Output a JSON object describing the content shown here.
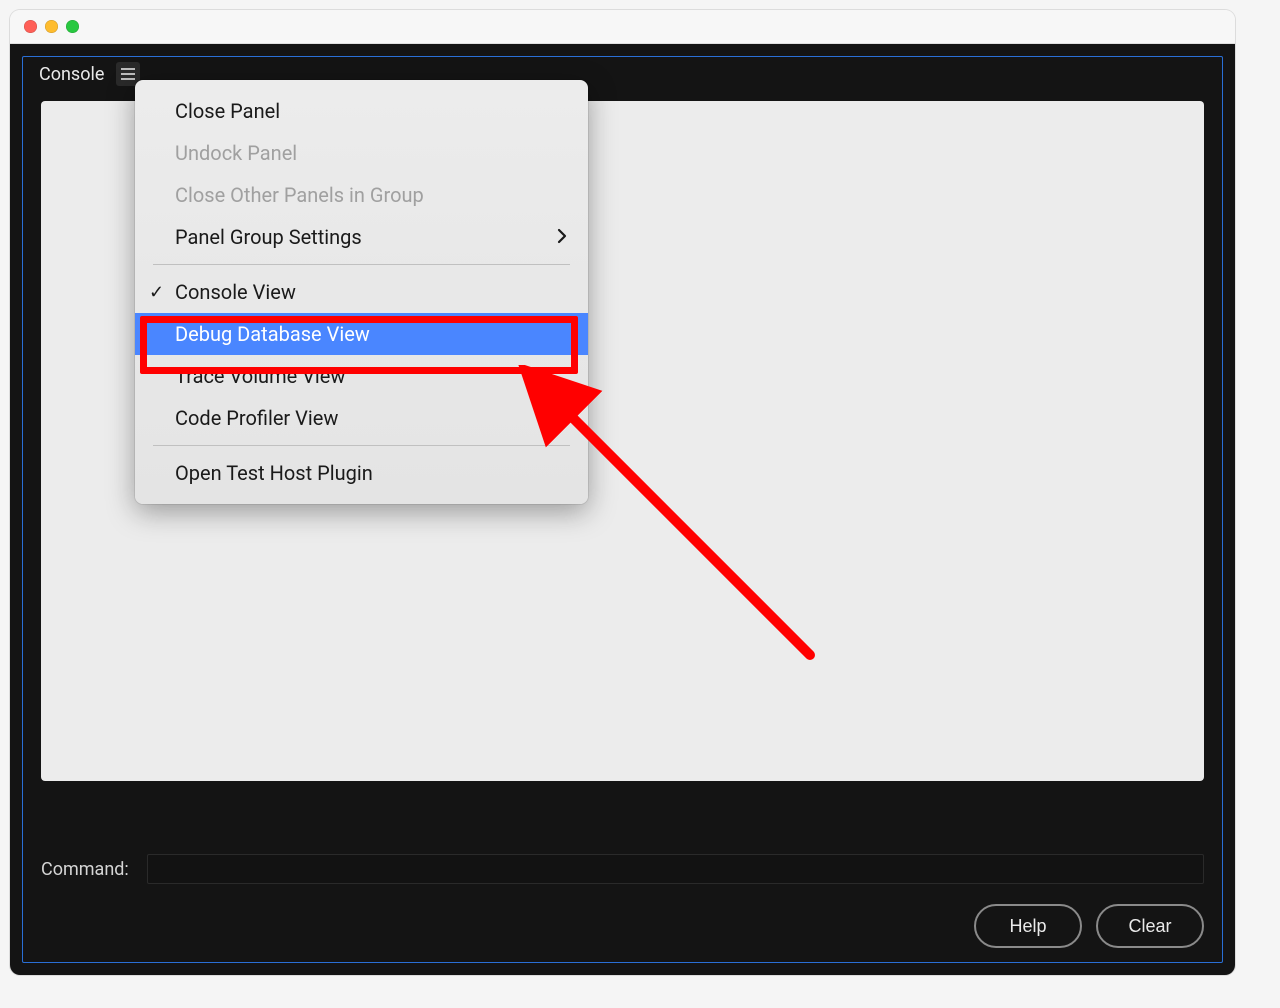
{
  "window": {
    "tab_title": "Console"
  },
  "menu": {
    "close_panel": "Close Panel",
    "undock_panel": "Undock Panel",
    "close_other_panels": "Close Other Panels in Group",
    "panel_group_settings": "Panel Group Settings",
    "console_view": "Console View",
    "debug_database_view": "Debug Database View",
    "trace_volume_view": "Trace Volume View",
    "code_profiler_view": "Code Profiler View",
    "open_test_host_plugin": "Open Test Host Plugin"
  },
  "footer": {
    "command_label": "Command:",
    "command_value": "",
    "help_button": "Help",
    "clear_button": "Clear"
  }
}
